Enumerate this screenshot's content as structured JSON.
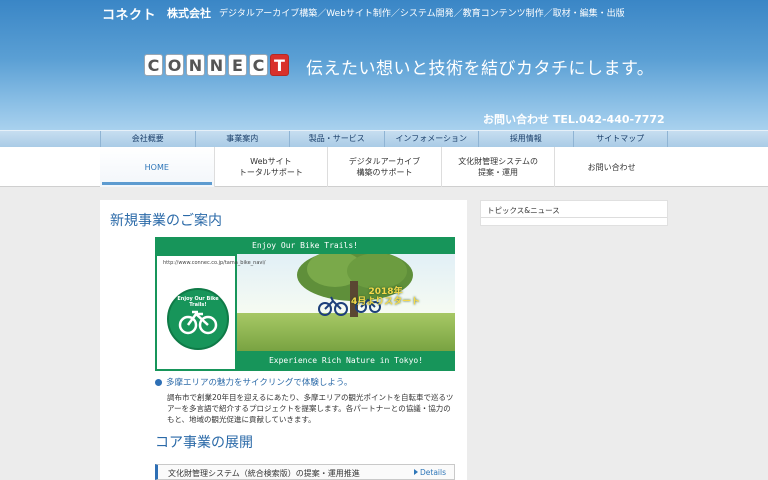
{
  "header": {
    "logo_text": "コネクト",
    "company_suffix": "株式会社",
    "tagline_top": "デジタルアーカイブ構築／Webサイト制作／システム開発／教育コンテンツ制作／取材・編集・出版",
    "brand_letters": [
      "C",
      "O",
      "N",
      "N",
      "E",
      "C",
      "T"
    ],
    "hero_tagline": "伝えたい想いと技術を結びカタチにします。",
    "contact": "お問い合わせ TEL.042-440-7772"
  },
  "topnav": {
    "items": [
      {
        "label": "会社概要"
      },
      {
        "label": "事業案内"
      },
      {
        "label": "製品・サービス"
      },
      {
        "label": "インフォメーション"
      },
      {
        "label": "採用情報"
      },
      {
        "label": "サイトマップ"
      }
    ]
  },
  "mainnav": {
    "items": [
      {
        "line1": "HOME",
        "line2": ""
      },
      {
        "line1": "Webサイト",
        "line2": "トータルサポート"
      },
      {
        "line1": "デジタルアーカイブ",
        "line2": "構築のサポート"
      },
      {
        "line1": "文化財管理システムの",
        "line2": "提案・運用"
      },
      {
        "line1": "お問い合わせ",
        "line2": ""
      }
    ]
  },
  "main": {
    "section_title": "新規事業のご案内",
    "banner": {
      "top_text": "Enjoy Our Bike Trails!",
      "url": "http://www.connec.co.jp/tama_bike_navi/",
      "emblem_text": "Enjoy Our Bike Trails!",
      "date_line1": "2018年",
      "date_line2": "4月よりスタート",
      "bottom_text": "Experience Rich Nature in Tokyo!"
    },
    "bullet_heading": "多摩エリアの魅力をサイクリングで体験しよう。",
    "description": "調布市で創業20年目を迎えるにあたり、多摩エリアの観光ポイントを自転車で巡るツアーを多言語で紹介するプロジェクトを提案します。各パートナーとの協議・協力のもと、地域の観光促進に貢献していきます。",
    "core_title": "コア事業の展開",
    "core_item_label": "文化財管理システム（統合検索版）の提案・運用推進",
    "details_label": "Details"
  },
  "sidebar": {
    "title": "トピックス&ニュース"
  },
  "colors": {
    "header_blue": "#3a86c6",
    "accent_blue": "#2b6aa8",
    "banner_green": "#17955a",
    "brand_red": "#d9312b"
  }
}
